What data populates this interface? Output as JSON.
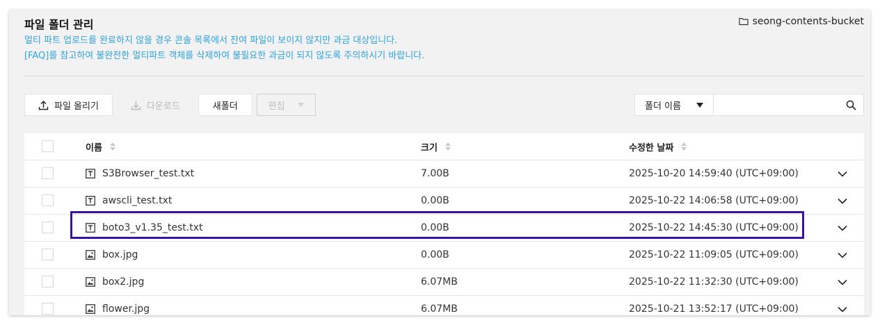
{
  "header": {
    "title": "파일 폴더 관리",
    "bucket_name": "seong-contents-bucket",
    "desc_line1": "멀티 파트 업로드를 완료하지 않을 경우 콘솔 목록에서 잔여 파일이 보이지 않지만 과금 대상입니다.",
    "desc_line2": "[FAQ]를 참고하여 불완전한 멀티파트 객체를 삭제하여 불필요한 과금이 되지 않도록 주의하시기 바랍니다."
  },
  "toolbar": {
    "upload_label": "파일 올리기",
    "download_label": "다운로드",
    "new_folder_label": "새폴더",
    "edit_label": "편집"
  },
  "search": {
    "select_value": "폴더 이름",
    "placeholder": ""
  },
  "table": {
    "columns": {
      "name": "이름",
      "size": "크기",
      "modified": "수정한 날짜"
    },
    "rows": [
      {
        "type": "text-file-icon",
        "name": "S3Browser_test.txt",
        "size": "7.00B",
        "modified": "2025-10-20 14:59:40 (UTC+09:00)"
      },
      {
        "type": "text-file-icon",
        "name": "awscli_test.txt",
        "size": "0.00B",
        "modified": "2025-10-22 14:06:58 (UTC+09:00)"
      },
      {
        "type": "text-file-icon",
        "name": "boto3_v1.35_test.txt",
        "size": "0.00B",
        "modified": "2025-10-22 14:45:30 (UTC+09:00)"
      },
      {
        "type": "image-file-icon",
        "name": "box.jpg",
        "size": "0.00B",
        "modified": "2025-10-22 11:09:05 (UTC+09:00)"
      },
      {
        "type": "image-file-icon",
        "name": "box2.jpg",
        "size": "6.07MB",
        "modified": "2025-10-22 11:32:30 (UTC+09:00)"
      },
      {
        "type": "image-file-icon",
        "name": "flower.jpg",
        "size": "6.07MB",
        "modified": "2025-10-21 13:52:17 (UTC+09:00)"
      }
    ]
  },
  "colors": {
    "accent_text": "#2ea3e0",
    "highlight_border": "#3a13a5",
    "panel_bg": "#f2f2f2"
  }
}
